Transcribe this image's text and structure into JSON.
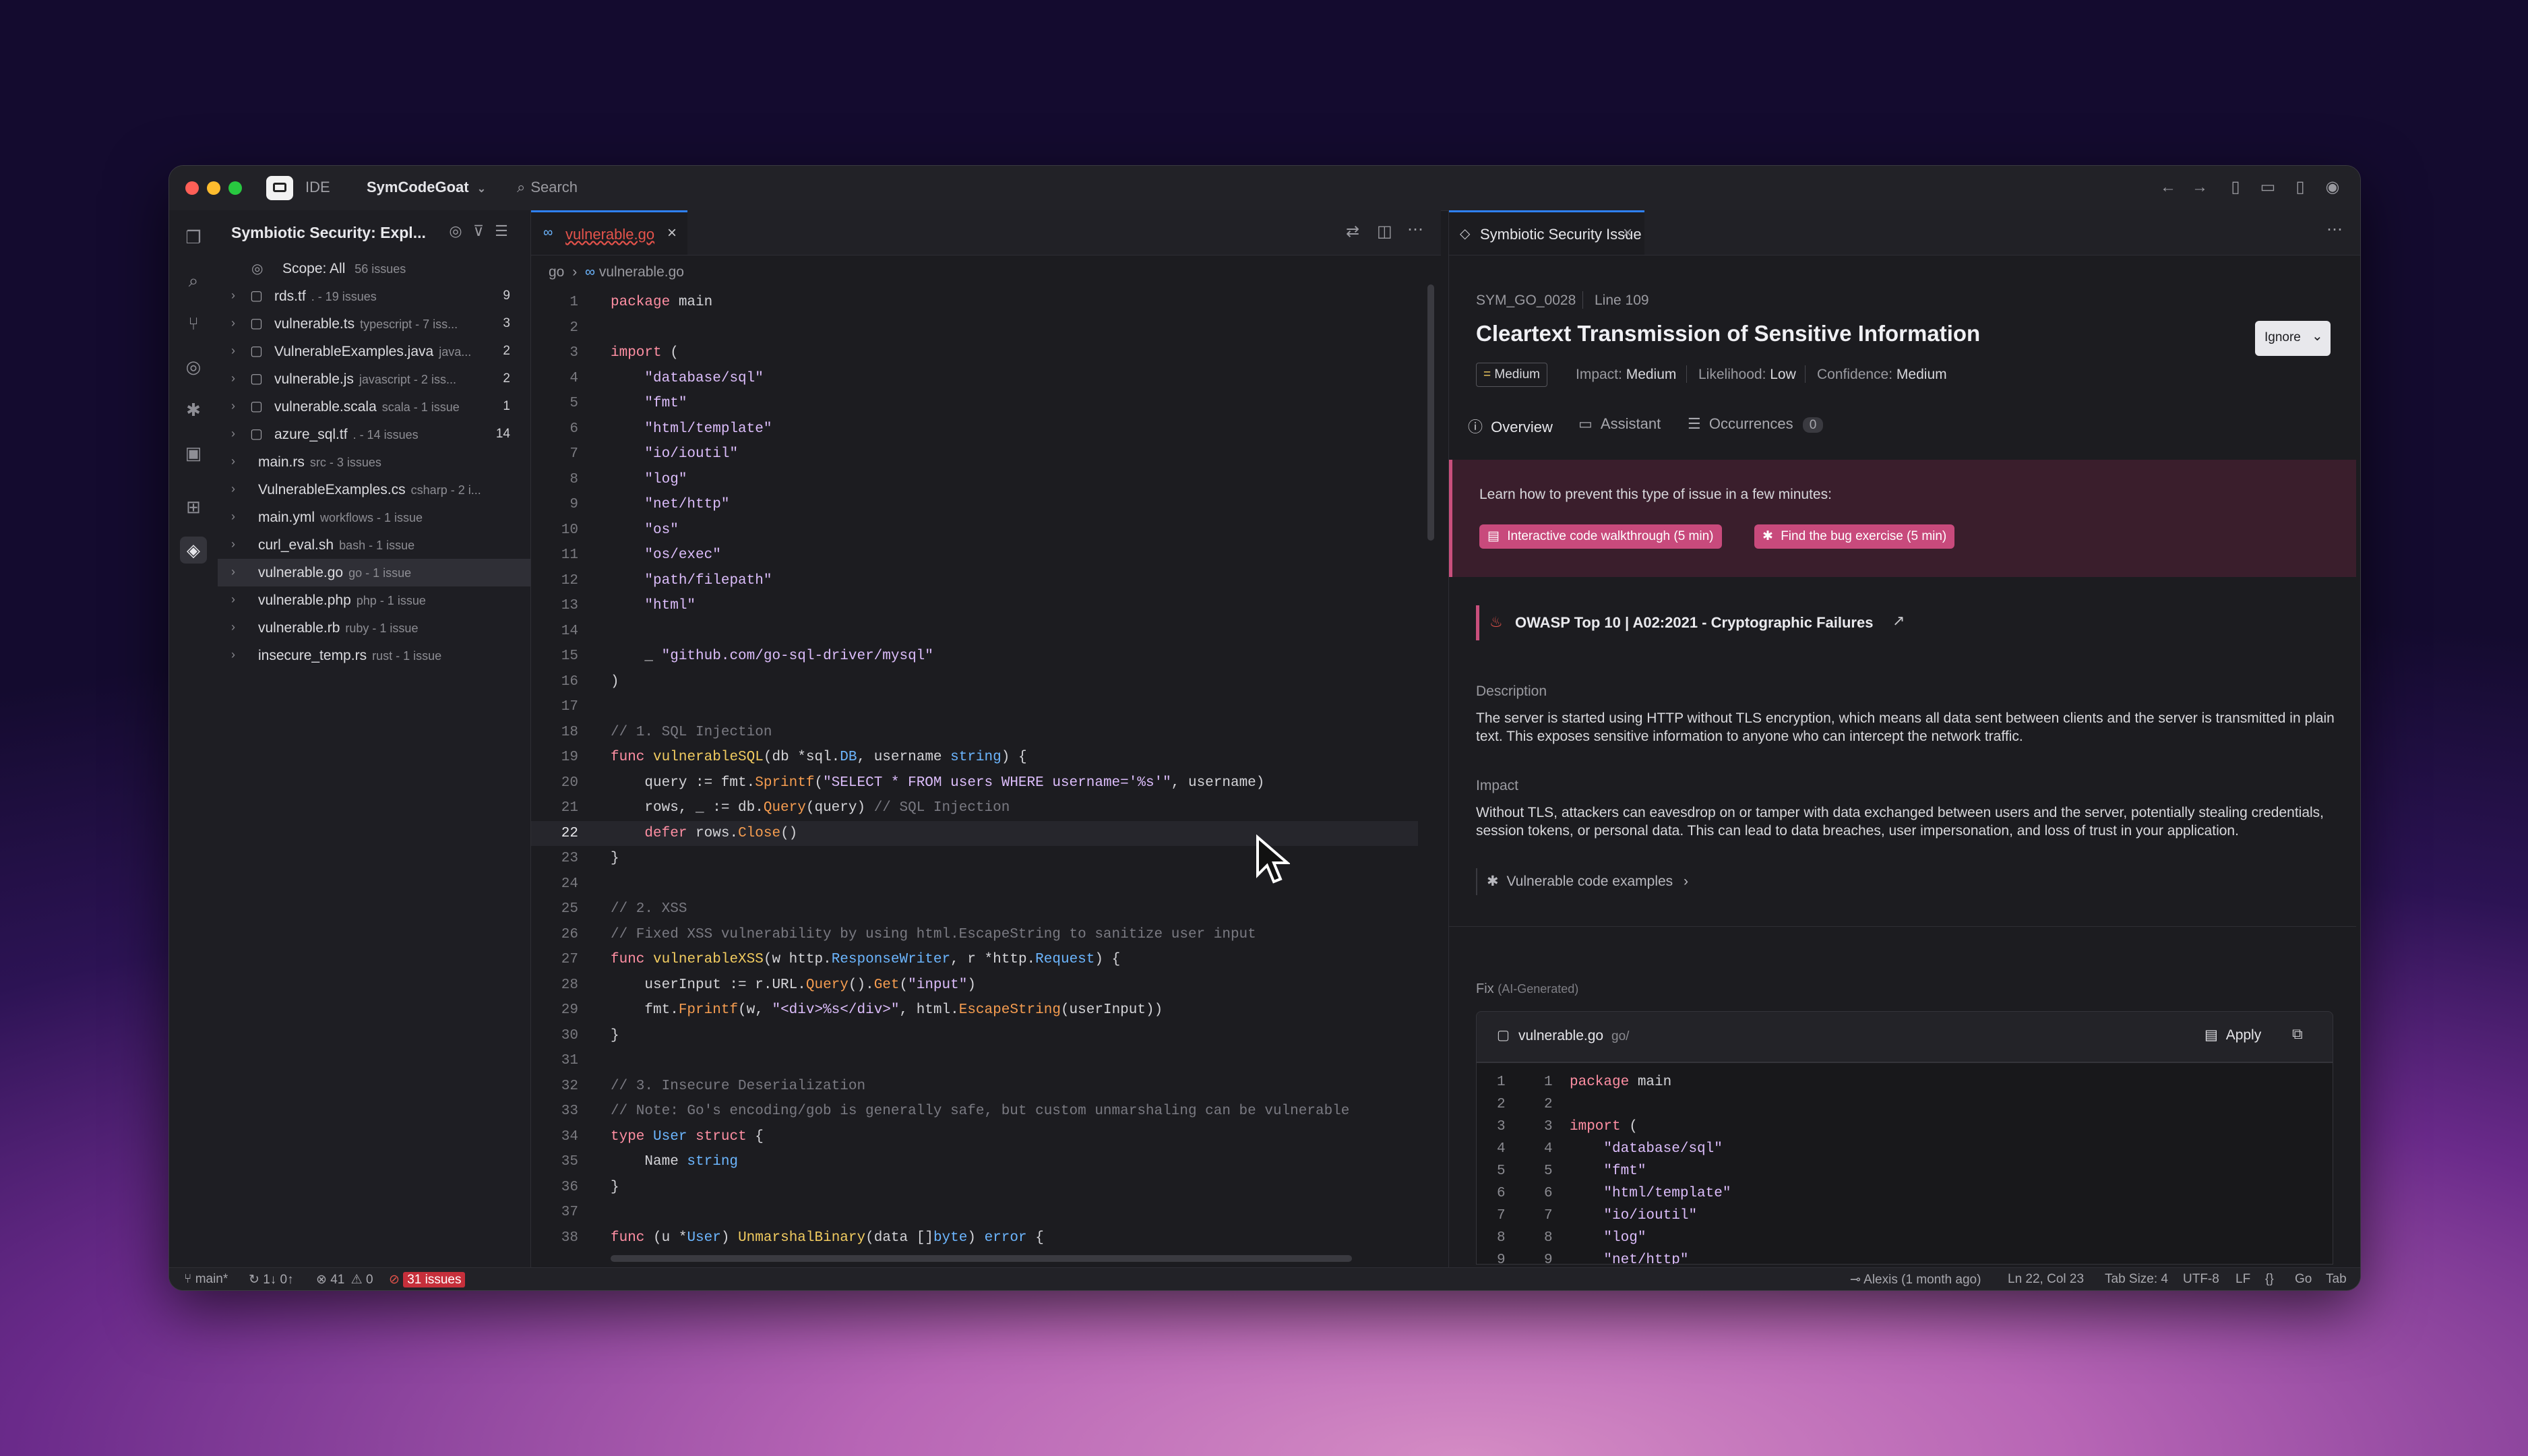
{
  "titlebar": {
    "ide_label": "IDE",
    "project": "SymCodeGoat",
    "search_placeholder": "Search"
  },
  "sidebar": {
    "title": "Symbiotic Security: Expl...",
    "scope_label": "Scope: All",
    "scope_count": "56 issues",
    "items": [
      {
        "name": "rds.tf",
        "meta": ". - 19 issues",
        "count": "9",
        "folder": true
      },
      {
        "name": "vulnerable.ts",
        "meta": "typescript - 7 iss...",
        "count": "3",
        "folder": true
      },
      {
        "name": "VulnerableExamples.java",
        "meta": "java...",
        "count": "2",
        "folder": true
      },
      {
        "name": "vulnerable.js",
        "meta": "javascript - 2 iss...",
        "count": "2",
        "folder": true
      },
      {
        "name": "vulnerable.scala",
        "meta": "scala - 1 issue",
        "count": "1",
        "folder": true
      },
      {
        "name": "azure_sql.tf",
        "meta": ". - 14 issues",
        "count": "14",
        "folder": true
      },
      {
        "name": "main.rs",
        "meta": "src - 3 issues",
        "count": "",
        "folder": false
      },
      {
        "name": "VulnerableExamples.cs",
        "meta": "csharp - 2 i...",
        "count": "",
        "folder": false
      },
      {
        "name": "main.yml",
        "meta": "workflows - 1 issue",
        "count": "",
        "folder": false
      },
      {
        "name": "curl_eval.sh",
        "meta": "bash - 1 issue",
        "count": "",
        "folder": false
      },
      {
        "name": "vulnerable.go",
        "meta": "go - 1 issue",
        "count": "",
        "folder": false
      },
      {
        "name": "vulnerable.php",
        "meta": "php - 1 issue",
        "count": "",
        "folder": false
      },
      {
        "name": "vulnerable.rb",
        "meta": "ruby - 1 issue",
        "count": "",
        "folder": false
      },
      {
        "name": "insecure_temp.rs",
        "meta": "rust - 1 issue",
        "count": "",
        "folder": false
      }
    ]
  },
  "editor": {
    "tab_label": "vulnerable.go",
    "breadcrumb_dir": "go",
    "breadcrumb_sep": "›",
    "breadcrumb_file": "vulnerable.go"
  },
  "panel": {
    "tab_label": "Symbiotic Security Issue",
    "rule_id": "SYM_GO_0028",
    "line": "Line 109",
    "title": "Cleartext Transmission of Sensitive Information",
    "ignore_label": "Ignore",
    "severity": "Medium",
    "impact_label": "Impact:",
    "impact_value": "Medium",
    "likelihood_label": "Likelihood:",
    "likelihood_value": "Low",
    "confidence_label": "Confidence:",
    "confidence_value": "Medium",
    "tabs": {
      "overview": "Overview",
      "assistant": "Assistant",
      "occurrences": "Occurrences",
      "occurrences_count": "0"
    },
    "learn_text": "Learn how to prevent this type of issue in a few minutes:",
    "walkthrough": "Interactive code walkthrough (5 min)",
    "exercise": "Find the bug exercise (5 min)",
    "owasp": "OWASP Top 10 | A02:2021 - Cryptographic Failures",
    "description_heading": "Description",
    "description": "The server is started using HTTP without TLS encryption, which means all data sent between clients and the server is transmitted in plain text. This exposes sensitive information to anyone who can intercept the network traffic.",
    "impact_heading": "Impact",
    "impact_text": "Without TLS, attackers can eavesdrop on or tamper with data exchanged between users and the server, potentially stealing credentials, session tokens, or personal data. This can lead to data breaches, user impersonation, and loss of trust in your application.",
    "examples_link": "Vulnerable code examples",
    "fix_heading": "Fix",
    "fix_sub": "(AI-Generated)",
    "fix_file": "vulnerable.go",
    "fix_path": "go/",
    "apply_label": "Apply"
  },
  "status": {
    "branch": "main*",
    "sync": "1↓ 0↑",
    "errors": "41",
    "warnings": "0",
    "issues": "31 issues",
    "blame": "Alexis (1 month ago)",
    "position": "Ln 22, Col 23",
    "tab_size": "Tab Size: 4",
    "encoding": "UTF-8",
    "eol": "LF",
    "braces": "{}",
    "language": "Go",
    "indent": "Tab"
  },
  "colors": {
    "accent": "#2f81f7",
    "security_pink": "#c84a7c",
    "error_red": "#c62f3b"
  },
  "icons": [
    "files-icon",
    "search-icon",
    "source-control-icon",
    "eye-icon",
    "bug-icon",
    "remote-icon",
    "extensions-icon",
    "symbiotic-icon"
  ]
}
